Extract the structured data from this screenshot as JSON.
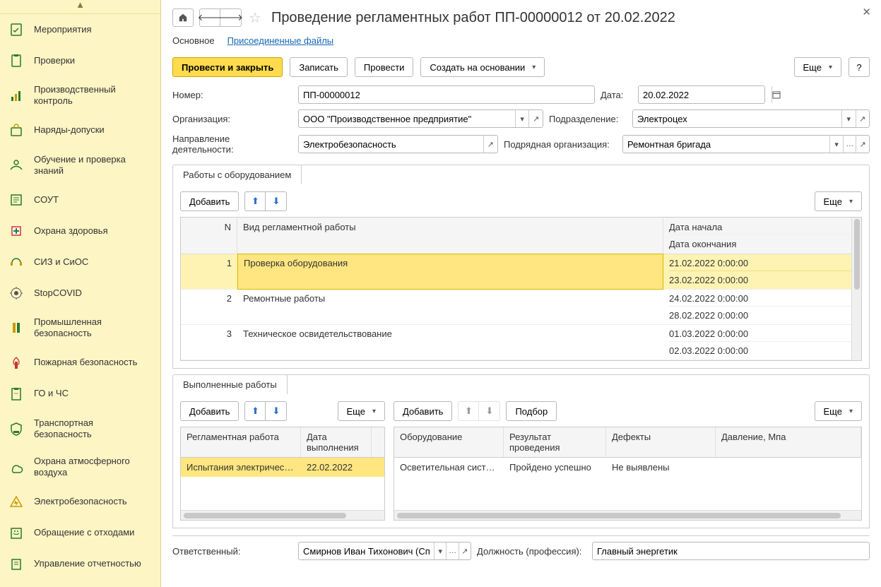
{
  "sidebar": {
    "items": [
      {
        "label": "Мероприятия"
      },
      {
        "label": "Проверки"
      },
      {
        "label": "Производственный контроль"
      },
      {
        "label": "Наряды-допуски"
      },
      {
        "label": "Обучение и проверка знаний"
      },
      {
        "label": "СОУТ"
      },
      {
        "label": "Охрана здоровья"
      },
      {
        "label": "СИЗ и СиОС"
      },
      {
        "label": "StopCOVID"
      },
      {
        "label": "Промышленная безопасность"
      },
      {
        "label": "Пожарная безопасность"
      },
      {
        "label": "ГО и ЧС"
      },
      {
        "label": "Транспортная безопасность"
      },
      {
        "label": "Охрана атмосферного воздуха"
      },
      {
        "label": "Электробезопасность"
      },
      {
        "label": "Обращение с отходами"
      },
      {
        "label": "Управление отчетностью"
      }
    ]
  },
  "header": {
    "title": "Проведение регламентных работ ПП-00000012 от 20.02.2022"
  },
  "tabsRow": {
    "main": "Основное",
    "attached": "Присоединенные файлы"
  },
  "cmdBar": {
    "postClose": "Провести и закрыть",
    "save": "Записать",
    "post": "Провести",
    "createBased": "Создать на основании",
    "more": "Еще",
    "help": "?"
  },
  "form": {
    "labels": {
      "number": "Номер:",
      "date": "Дата:",
      "org": "Организация:",
      "dept": "Подразделение:",
      "direction": "Направление деятельности:",
      "contractor": "Подрядная организация:",
      "responsible": "Ответственный:",
      "position": "Должность (профессия):"
    },
    "values": {
      "number": "ПП-00000012",
      "date": "20.02.2022",
      "org": "ООО \"Производственное предприятие\"",
      "dept": "Электроцех",
      "direction": "Электробезопасность",
      "contractor": "Ремонтная бригада",
      "responsible": "Смирнов Иван Тихонович (Сп",
      "position": "Главный энергетик"
    }
  },
  "equipTab": {
    "title": "Работы с оборудованием",
    "add": "Добавить",
    "more": "Еще",
    "columns": {
      "n": "N",
      "type": "Вид регламентной работы",
      "start": "Дата начала",
      "end": "Дата окончания"
    },
    "rows": [
      {
        "n": "1",
        "type": "Проверка оборудования",
        "start": "21.02.2022 0:00:00",
        "end": "23.02.2022 0:00:00"
      },
      {
        "n": "2",
        "type": "Ремонтные работы",
        "start": "24.02.2022 0:00:00",
        "end": "28.02.2022 0:00:00"
      },
      {
        "n": "3",
        "type": "Техническое освидетельствование",
        "start": "01.03.2022 0:00:00",
        "end": "02.03.2022 0:00:00"
      }
    ]
  },
  "doneTab": {
    "title": "Выполненные работы",
    "add": "Добавить",
    "more": "Еще",
    "pick": "Подбор",
    "left": {
      "columns": {
        "reg": "Регламентная работа",
        "date": "Дата выполнения"
      },
      "rows": [
        {
          "reg": "Испытания электрическ...",
          "date": "22.02.2022"
        }
      ]
    },
    "right": {
      "columns": {
        "equip": "Оборудование",
        "result": "Результат проведения",
        "defects": "Дефекты",
        "pressure": "Давление, Мпа"
      },
      "rows": [
        {
          "equip": "Осветительная систе...",
          "result": "Пройдено успешно",
          "defects": "Не выявлены",
          "pressure": ""
        }
      ]
    }
  }
}
